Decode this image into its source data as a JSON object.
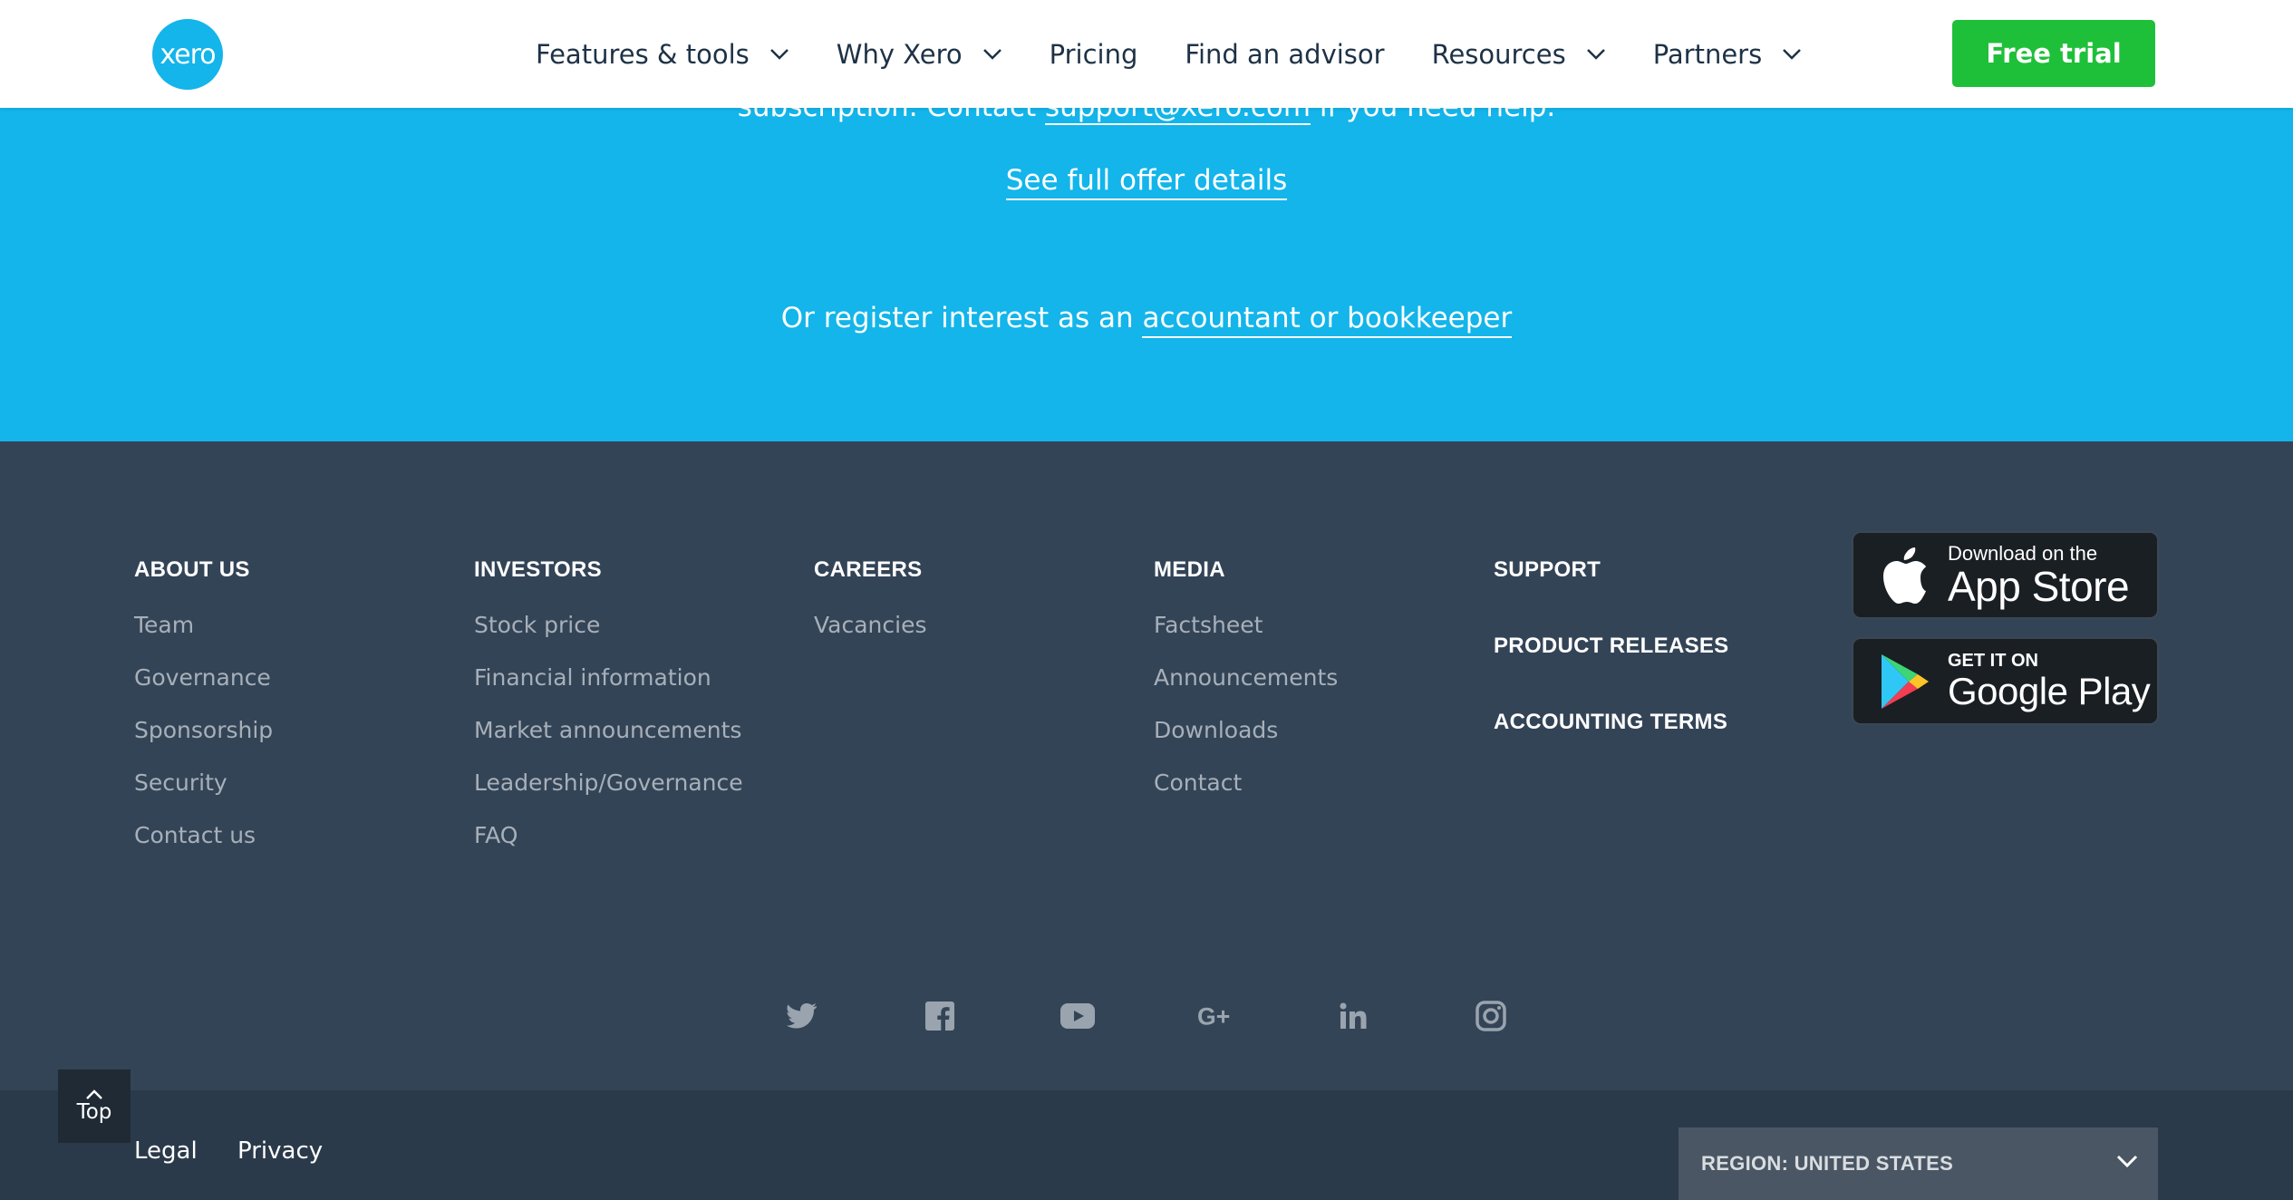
{
  "nav": {
    "logo_text": "xero",
    "items": [
      {
        "label": "Features & tools",
        "has_dropdown": true
      },
      {
        "label": "Why Xero",
        "has_dropdown": true
      },
      {
        "label": "Pricing",
        "has_dropdown": false
      },
      {
        "label": "Find an advisor",
        "has_dropdown": false
      },
      {
        "label": "Resources",
        "has_dropdown": true
      },
      {
        "label": "Partners",
        "has_dropdown": true
      }
    ],
    "cta_label": "Free trial"
  },
  "promo": {
    "top_line_prefix": "subscription. Contact ",
    "top_line_email": "support@xero.com",
    "top_line_suffix": " if you need help.",
    "offer_details_link": "See full offer details",
    "register_prefix": "Or register interest as an ",
    "register_link": "accountant or bookkeeper"
  },
  "footer": {
    "columns": [
      {
        "heading": "ABOUT US",
        "links": [
          "Team",
          "Governance",
          "Sponsorship",
          "Security",
          "Contact us"
        ]
      },
      {
        "heading": "INVESTORS",
        "links": [
          "Stock price",
          "Financial information",
          "Market announcements",
          "Leadership/Governance",
          "FAQ"
        ]
      },
      {
        "heading": "CAREERS",
        "links": [
          "Vacancies"
        ]
      },
      {
        "heading": "MEDIA",
        "links": [
          "Factsheet",
          "Announcements",
          "Downloads",
          "Contact"
        ]
      }
    ],
    "support_headings": [
      "SUPPORT",
      "PRODUCT RELEASES",
      "ACCOUNTING TERMS"
    ],
    "app_store": {
      "small": "Download on the",
      "big": "App Store"
    },
    "google_play": {
      "small": "GET IT ON",
      "big": "Google Play"
    },
    "social_icons": [
      "twitter-icon",
      "facebook-icon",
      "youtube-icon",
      "google-plus-icon",
      "linkedin-icon",
      "instagram-icon"
    ]
  },
  "bottom": {
    "legal": "Legal",
    "privacy": "Privacy",
    "region": "REGION: UNITED STATES",
    "top_button": "Top"
  },
  "colors": {
    "brand_blue": "#13b5ea",
    "cta_green": "#1fc039",
    "footer_bg": "#344457",
    "nav_text": "#1e3246"
  }
}
